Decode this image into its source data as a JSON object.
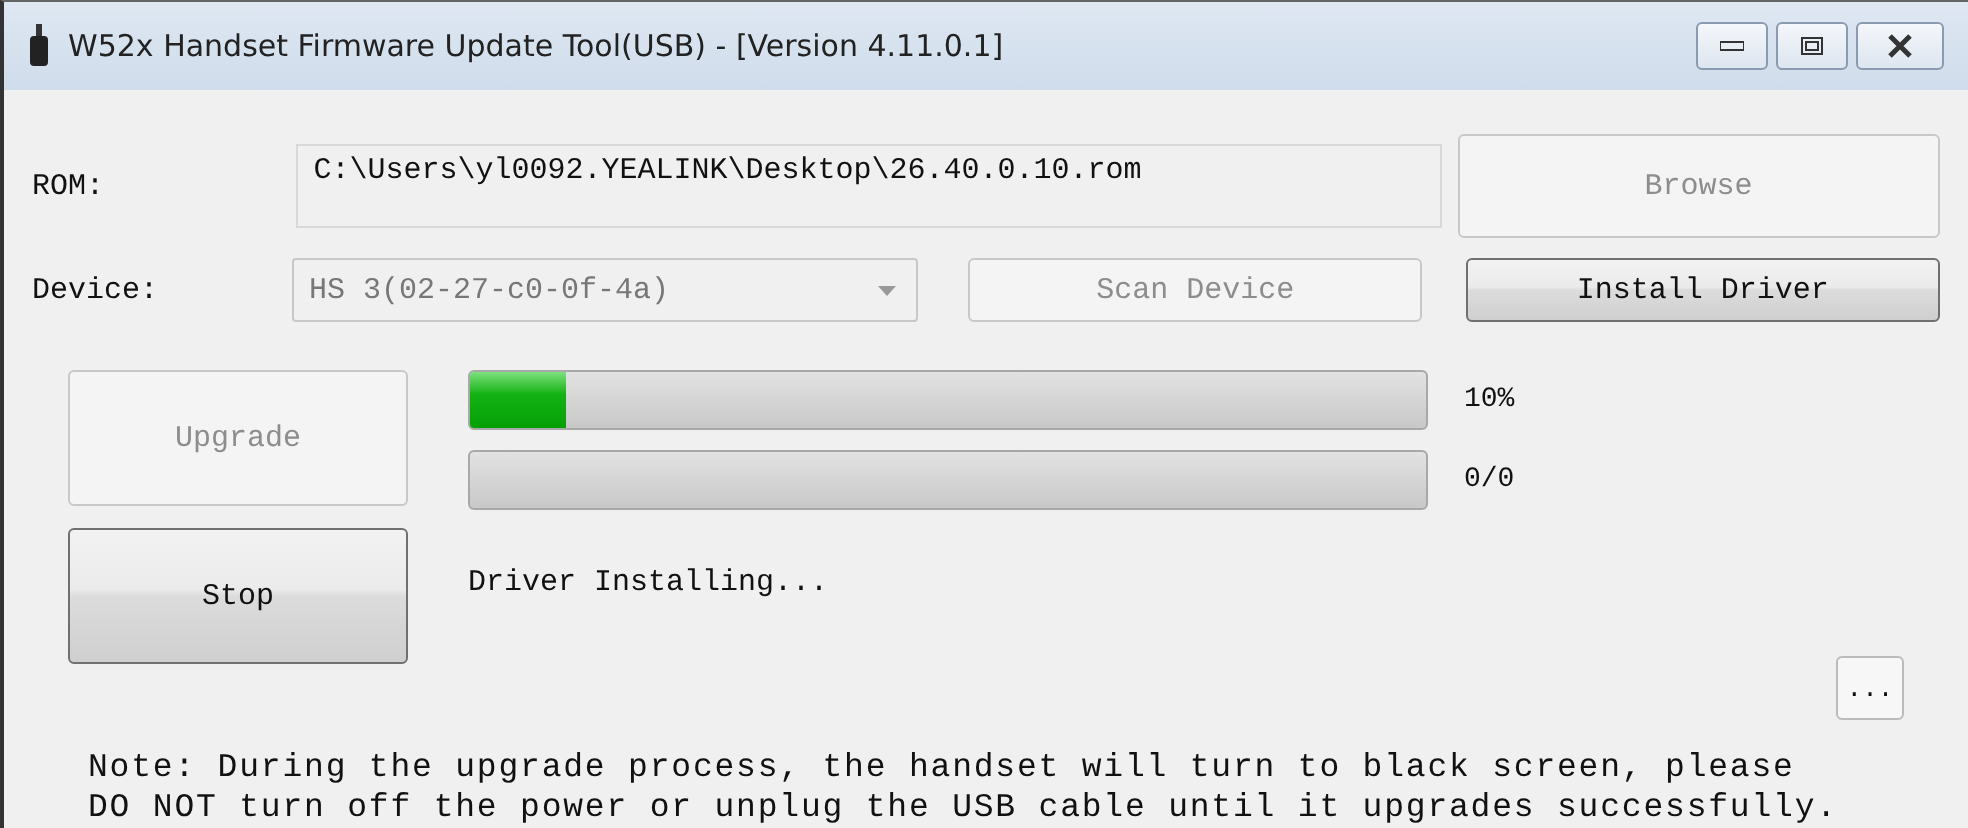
{
  "window": {
    "title": "W52x Handset Firmware Update Tool(USB) - [Version 4.11.0.1]"
  },
  "rom": {
    "label": "ROM:",
    "value": "C:\\Users\\yl0092.YEALINK\\Desktop\\26.40.0.10.rom"
  },
  "browse": {
    "label": "Browse",
    "disabled": true
  },
  "device": {
    "label": "Device:",
    "value": "HS 3(02-27-c0-0f-4a)",
    "disabled": true
  },
  "scan": {
    "label": "Scan Device",
    "disabled": true
  },
  "install": {
    "label": "Install Driver",
    "disabled": false
  },
  "upgrade": {
    "label": "Upgrade",
    "disabled": true
  },
  "stop": {
    "label": "Stop",
    "disabled": false
  },
  "progress": [
    {
      "level": 0.1,
      "reading": "10%"
    },
    {
      "level": 0,
      "reading": "0/0"
    }
  ],
  "status": "Driver Installing...",
  "more": {
    "label": "...",
    "disabled": false
  },
  "note": [
    "Note: During the upgrade process, the handset will turn to black screen, please",
    "DO NOT turn off the power or unplug the USB cable until it upgrades successfully."
  ]
}
